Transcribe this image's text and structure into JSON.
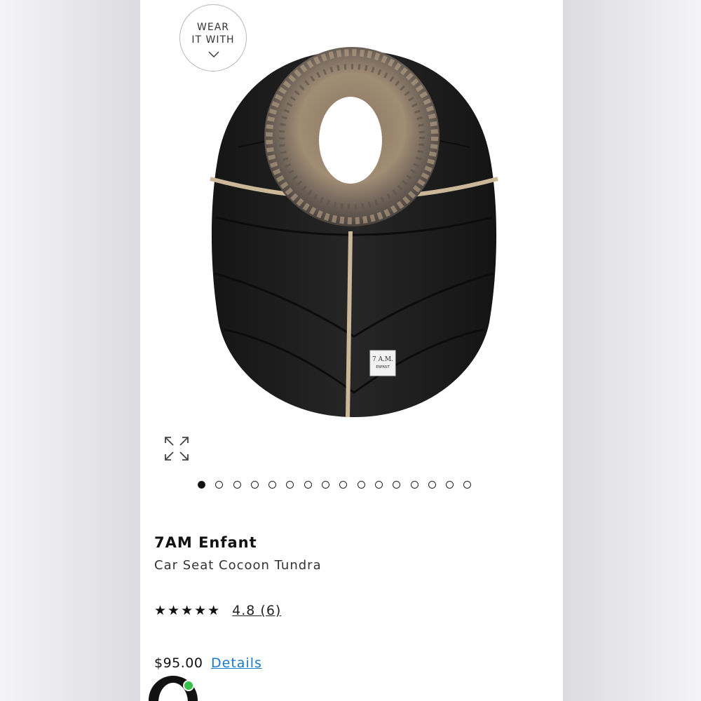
{
  "wear_it_with": {
    "line1": "WEAR",
    "line2": "IT WITH",
    "icon": "chevron-down-icon"
  },
  "gallery": {
    "image_description": "black puffer car seat cocoon with faux-fur trimmed hood",
    "label_text": "7 A.M. ENFANT",
    "expand_icon": "expand-icon",
    "slide_count": 16,
    "active_slide": 1
  },
  "product": {
    "brand": "7AM Enfant",
    "name": "Car Seat Cocoon Tundra",
    "stars": "★★★★★",
    "rating_text": "4.8 (6)",
    "price": "$95.00",
    "details_label": "Details"
  },
  "colors": {
    "details_link": "#1a7ac9",
    "avatar_status": "#35c04a"
  }
}
